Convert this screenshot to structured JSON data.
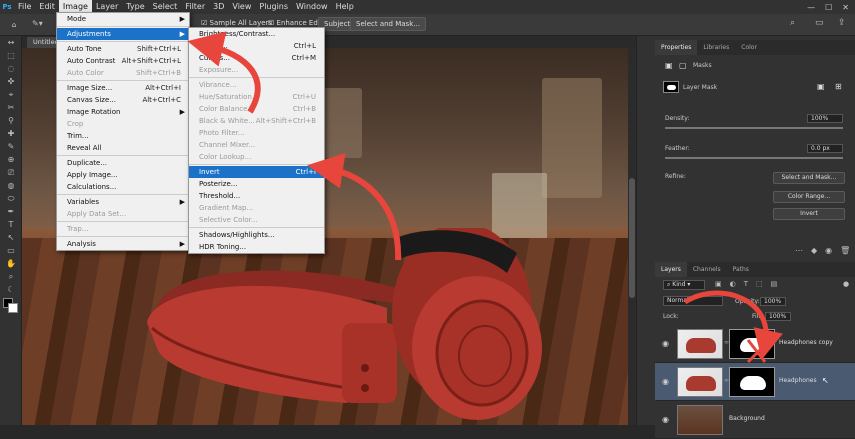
{
  "menubar": {
    "logo": "Ps",
    "items": [
      "File",
      "Edit",
      "Image",
      "Layer",
      "Type",
      "Select",
      "Filter",
      "3D",
      "View",
      "Plugins",
      "Window",
      "Help"
    ],
    "active_index": 2
  },
  "options": {
    "sample_all_layers": "Sample All Layers",
    "enhance_edge": "Enhance Edge",
    "subject": "Subject",
    "select_mask": "Select and Mask..."
  },
  "document_tab": "Untitled",
  "image_menu": [
    {
      "label": "Mode",
      "shortcut": "",
      "arrow": true,
      "disabled": false,
      "sep_after": true
    },
    {
      "label": "Adjustments",
      "shortcut": "",
      "arrow": true,
      "disabled": false,
      "highlight": true,
      "sep_after": true
    },
    {
      "label": "Auto Tone",
      "shortcut": "Shift+Ctrl+L",
      "disabled": false
    },
    {
      "label": "Auto Contrast",
      "shortcut": "Alt+Shift+Ctrl+L",
      "disabled": false
    },
    {
      "label": "Auto Color",
      "shortcut": "Shift+Ctrl+B",
      "disabled": true,
      "sep_after": true
    },
    {
      "label": "Image Size...",
      "shortcut": "Alt+Ctrl+I",
      "disabled": false
    },
    {
      "label": "Canvas Size...",
      "shortcut": "Alt+Ctrl+C",
      "disabled": false
    },
    {
      "label": "Image Rotation",
      "shortcut": "",
      "arrow": true,
      "disabled": false
    },
    {
      "label": "Crop",
      "shortcut": "",
      "disabled": true
    },
    {
      "label": "Trim...",
      "shortcut": "",
      "disabled": false
    },
    {
      "label": "Reveal All",
      "shortcut": "",
      "disabled": false,
      "sep_after": true
    },
    {
      "label": "Duplicate...",
      "shortcut": "",
      "disabled": false
    },
    {
      "label": "Apply Image...",
      "shortcut": "",
      "disabled": false
    },
    {
      "label": "Calculations...",
      "shortcut": "",
      "disabled": false,
      "sep_after": true
    },
    {
      "label": "Variables",
      "shortcut": "",
      "arrow": true,
      "disabled": false
    },
    {
      "label": "Apply Data Set...",
      "shortcut": "",
      "disabled": true,
      "sep_after": true
    },
    {
      "label": "Trap...",
      "shortcut": "",
      "disabled": true,
      "sep_after": true
    },
    {
      "label": "Analysis",
      "shortcut": "",
      "arrow": true,
      "disabled": false
    }
  ],
  "adjust_menu": [
    {
      "label": "Brightness/Contrast...",
      "shortcut": "",
      "disabled": false
    },
    {
      "label": "Levels...",
      "shortcut": "Ctrl+L",
      "disabled": false
    },
    {
      "label": "Curves...",
      "shortcut": "Ctrl+M",
      "disabled": false
    },
    {
      "label": "Exposure...",
      "shortcut": "",
      "disabled": true,
      "sep_after": true
    },
    {
      "label": "Vibrance...",
      "shortcut": "",
      "disabled": true
    },
    {
      "label": "Hue/Saturation...",
      "shortcut": "Ctrl+U",
      "disabled": true
    },
    {
      "label": "Color Balance...",
      "shortcut": "Ctrl+B",
      "disabled": true
    },
    {
      "label": "Black & White...",
      "shortcut": "Alt+Shift+Ctrl+B",
      "disabled": true
    },
    {
      "label": "Photo Filter...",
      "shortcut": "",
      "disabled": true
    },
    {
      "label": "Channel Mixer...",
      "shortcut": "",
      "disabled": true
    },
    {
      "label": "Color Lookup...",
      "shortcut": "",
      "disabled": true,
      "sep_after": true
    },
    {
      "label": "Invert",
      "shortcut": "Ctrl+I",
      "disabled": false,
      "highlight": true
    },
    {
      "label": "Posterize...",
      "shortcut": "",
      "disabled": false
    },
    {
      "label": "Threshold...",
      "shortcut": "",
      "disabled": false
    },
    {
      "label": "Gradient Map...",
      "shortcut": "",
      "disabled": true
    },
    {
      "label": "Selective Color...",
      "shortcut": "",
      "disabled": true,
      "sep_after": true
    },
    {
      "label": "Shadows/Highlights...",
      "shortcut": "",
      "disabled": false
    },
    {
      "label": "HDR Toning...",
      "shortcut": "",
      "disabled": false
    }
  ],
  "properties": {
    "tabs": [
      "Properties",
      "Libraries",
      "Color"
    ],
    "masks_label": "Masks",
    "layer_mask_label": "Layer Mask",
    "density_label": "Density:",
    "density_value": "100%",
    "feather_label": "Feather:",
    "feather_value": "0.0 px",
    "refine_label": "Refine:",
    "buttons": [
      "Select and Mask...",
      "Color Range...",
      "Invert"
    ]
  },
  "layers": {
    "tabs": [
      "Layers",
      "Channels",
      "Paths"
    ],
    "kind": "Kind",
    "opacity_label": "Opacity:",
    "opacity_value": "100%",
    "lock_label": "Lock:",
    "fill_label": "Fill:",
    "fill_value": "100%",
    "mode": "Normal",
    "items": [
      {
        "name": "Headphones copy",
        "selected": false,
        "mask": true
      },
      {
        "name": "Headphones",
        "selected": true,
        "mask": true
      },
      {
        "name": "Background",
        "selected": false,
        "mask": false
      }
    ]
  },
  "colors": {
    "accent": "#1c72c8",
    "arrow": "#e8453c",
    "headphone": "#b83a30"
  }
}
